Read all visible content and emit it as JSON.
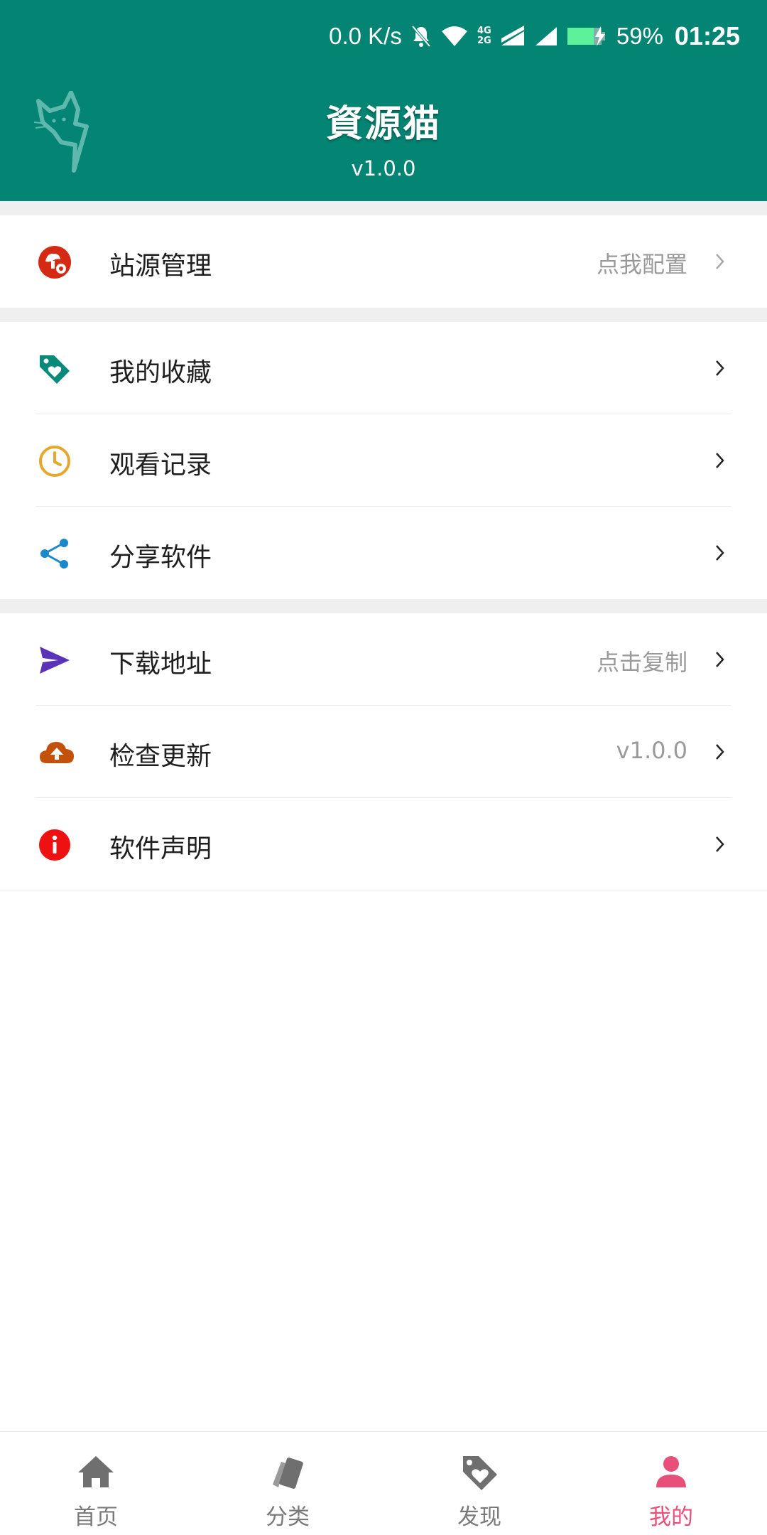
{
  "status_bar": {
    "speed": "0.0 K/s",
    "network": "4G 2G",
    "battery": "59%",
    "time": "01:25"
  },
  "header": {
    "title": "資源猫",
    "version": "v1.0.0"
  },
  "menu": {
    "station": {
      "label": "站源管理",
      "value": "点我配置",
      "icon": "mushroom-gear-icon",
      "color": "#d42a13"
    },
    "favorites": {
      "label": "我的收藏",
      "icon": "tag-heart-icon",
      "color": "#068a79"
    },
    "history": {
      "label": "观看记录",
      "icon": "clock-icon",
      "color": "#e7a72a"
    },
    "share": {
      "label": "分享软件",
      "icon": "share-icon",
      "color": "#1b88c9"
    },
    "download": {
      "label": "下载地址",
      "value": "点击复制",
      "icon": "send-icon",
      "color": "#5b33b8"
    },
    "update": {
      "label": "检查更新",
      "value": "v1.0.0",
      "icon": "cloud-upload-icon",
      "color": "#c2510c"
    },
    "statement": {
      "label": "软件声明",
      "icon": "info-icon",
      "color": "#ee1111"
    }
  },
  "bottom_nav": {
    "items": [
      {
        "label": "首页",
        "icon": "home-icon",
        "active": false
      },
      {
        "label": "分类",
        "icon": "cards-icon",
        "active": false
      },
      {
        "label": "发现",
        "icon": "tag-heart-icon",
        "active": false
      },
      {
        "label": "我的",
        "icon": "user-icon",
        "active": true
      }
    ],
    "active_color": "#e8507a",
    "inactive_color": "#7a7a7a"
  }
}
